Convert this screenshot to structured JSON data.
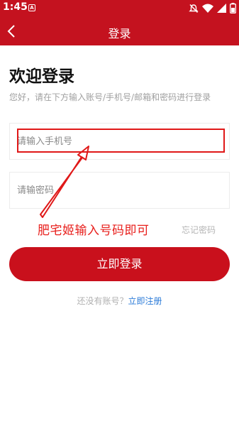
{
  "status_bar": {
    "time": "1:45",
    "app_icon_letter": "A",
    "icons": [
      "app-notification-icon",
      "mute-icon",
      "wifi-icon",
      "signal-icon",
      "battery-icon"
    ]
  },
  "app_bar": {
    "title": "登录",
    "back_icon": "chevron-left-icon",
    "background_color": "#c4121f"
  },
  "login": {
    "welcome": "欢迎登录",
    "hint": "您好，请在下方输入账号/手机号/邮箱和密码进行登录",
    "phone_placeholder": "请输入手机号",
    "password_placeholder": "请输密码",
    "forgot_password": "忘记密码",
    "submit_label": "立即登录",
    "no_account_text": "还没有账号？",
    "register_link": "立即注册"
  },
  "annotation": {
    "text": "肥宅姬输入号码即可",
    "color": "#e8201d"
  },
  "colors": {
    "accent": "#c4121f",
    "link": "#2b7bd8"
  }
}
